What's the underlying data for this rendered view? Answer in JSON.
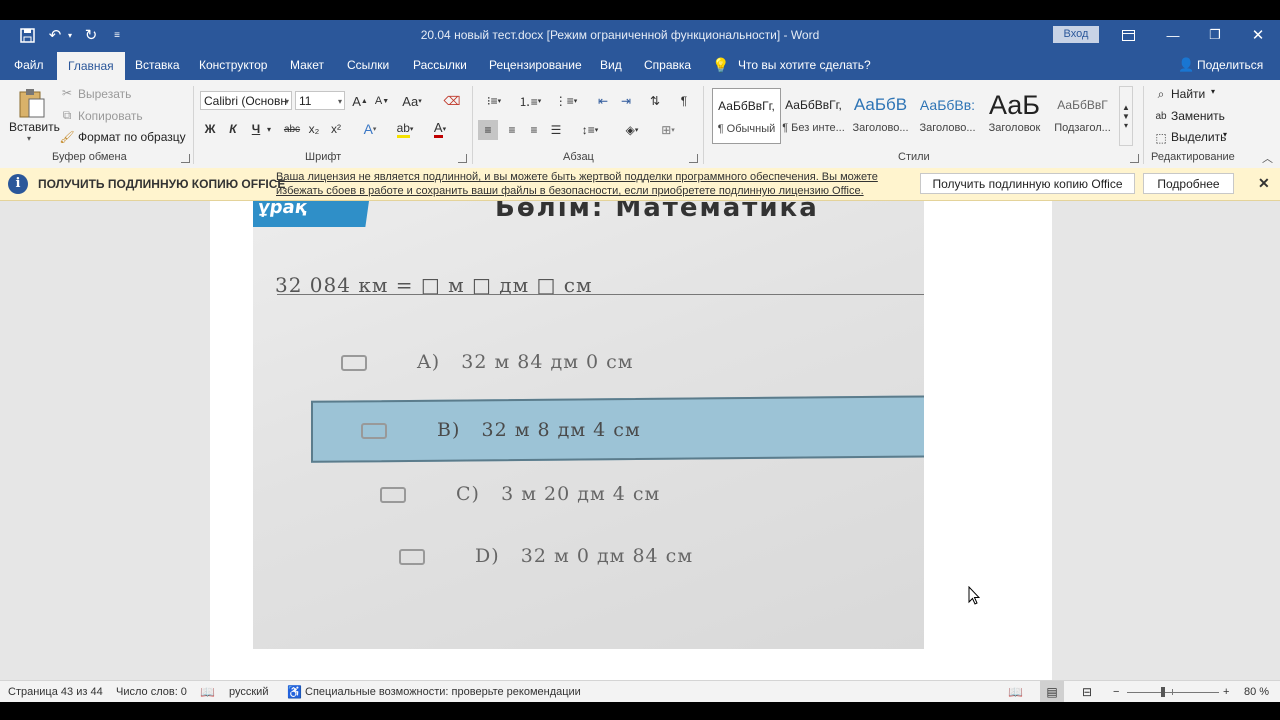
{
  "window": {
    "title": "20.04 новый тест.docx [Режим ограниченной функциональности]  -  Word",
    "signin_label": "Вход"
  },
  "tabs": [
    "Файл",
    "Главная",
    "Вставка",
    "Конструктор",
    "Макет",
    "Ссылки",
    "Рассылки",
    "Рецензирование",
    "Вид",
    "Справка"
  ],
  "tell_me": "Что вы хотите сделать?",
  "share_label": "Поделиться",
  "clipboard": {
    "paste_label": "Вставить",
    "cut_label": "Вырезать",
    "copy_label": "Копировать",
    "format_painter_label": "Формат по образцу",
    "group_label": "Буфер обмена"
  },
  "font": {
    "name": "Calibri (Основн",
    "size": "11",
    "group_label": "Шрифт",
    "bold": "Ж",
    "italic": "К",
    "underline": "Ч",
    "strike": "abc",
    "sub": "x₂",
    "sup": "x²"
  },
  "paragraph": {
    "group_label": "Абзац"
  },
  "styles": {
    "group_label": "Стили",
    "items": [
      {
        "sample": "АаБбВвГг,",
        "name": "¶ Обычный"
      },
      {
        "sample": "АаБбВвГг,",
        "name": "¶ Без инте..."
      },
      {
        "sample": "АаБбВ",
        "name": "Заголово..."
      },
      {
        "sample": "АаБбВв:",
        "name": "Заголово..."
      },
      {
        "sample": "АаБ",
        "name": "Заголовок"
      },
      {
        "sample": "АаБбВвГ",
        "name": "Подзагол..."
      }
    ]
  },
  "editing": {
    "find_label": "Найти",
    "replace_label": "Заменить",
    "select_label": "Выделить",
    "group_label": "Редактирование"
  },
  "infobar": {
    "title": "ПОЛУЧИТЬ ПОДЛИННУЮ КОПИЮ OFFICE",
    "message": "Ваша лицензия не является подлинной, и вы можете быть жертвой подделки программного обеспечения. Вы можете избежать сбоев в работе и сохранить ваши файлы в безопасности, если приобретете подлинную лицензию Office.",
    "get_button": "Получить подлинную копию Office",
    "more_button": "Подробнее"
  },
  "document_image": {
    "tab_text": "ұрақ",
    "heading": "Бөлім: Математика",
    "question": "32 084 км = □ м □ дм □ см",
    "options": [
      {
        "letter": "A)",
        "text": "32 м 84 дм 0 см"
      },
      {
        "letter": "B)",
        "text": "32 м 8 дм 4 см"
      },
      {
        "letter": "C)",
        "text": "3 м 20 дм 4 см"
      },
      {
        "letter": "D)",
        "text": "32 м 0 дм 84 см"
      }
    ],
    "selected_option": "B)"
  },
  "statusbar": {
    "page": "Страница 43 из 44",
    "words": "Число слов: 0",
    "language": "русский",
    "accessibility": "Специальные возможности: проверьте рекомендации",
    "zoom": "80 %"
  }
}
